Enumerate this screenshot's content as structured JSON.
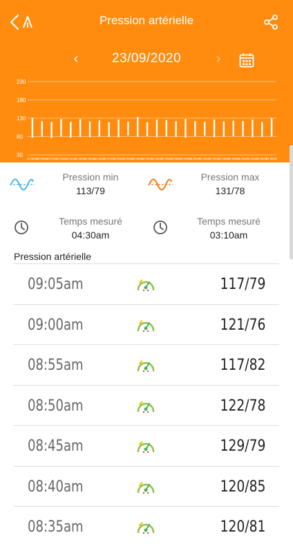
{
  "header": {
    "title": "Pression artérielle",
    "back_icon": "chevron-left-icon",
    "brand_icon": "app-logo-icon",
    "share_icon": "share-icon",
    "background": "#ff8c0f"
  },
  "date_nav": {
    "date": "23/09/2020",
    "prev_symbol": "‹",
    "next_symbol": "›",
    "calendar_icon": "calendar-icon"
  },
  "chart_data": {
    "type": "range-bar",
    "y_ticks": [
      230,
      180,
      130,
      80,
      30
    ],
    "ylim": [
      30,
      230
    ],
    "grid": true,
    "x_tick_labels": [
      "12:00am",
      "12:06am",
      "12:07am",
      "12:10am",
      "12:11am",
      "12:18am",
      "12:20am",
      "12:22am",
      "12:27am",
      "12:30am",
      "12:36am",
      "12:40am",
      "12:44am",
      "12:45am",
      "12:50am",
      "12:55am",
      "01:00am",
      "01:06am",
      "01:10am",
      "01:15am",
      "01:18am",
      "01:20am",
      "01:25am",
      "01:30am",
      "01:35am",
      "01:40am"
    ],
    "series": [
      {
        "values_min": [
          77,
          80,
          76,
          80,
          77,
          79,
          78,
          80,
          79,
          78,
          83,
          79,
          81,
          78,
          80,
          79,
          77,
          80,
          82,
          78,
          79,
          81,
          80,
          78,
          79,
          80
        ],
        "values_max": [
          131,
          122,
          120,
          128,
          120,
          127,
          121,
          124,
          119,
          126,
          121,
          133,
          119,
          126,
          125,
          122,
          128,
          122,
          120,
          126,
          121,
          123,
          122,
          126,
          120,
          131
        ]
      }
    ],
    "color": "#ffffff"
  },
  "summary": {
    "min_label": "Pression min",
    "min_value": "113/79",
    "max_label": "Pression max",
    "max_value": "131/78",
    "min_time_label": "Temps mesuré",
    "min_time_value": "04:30am",
    "max_time_label": "Temps mesuré",
    "max_time_value": "03:10am",
    "min_icon": "wave-blue-icon",
    "max_icon": "wave-orange-icon",
    "clock_icon": "clock-icon",
    "min_color": "#4ab3e8",
    "max_color": "#f07a1a"
  },
  "list": {
    "title": "Pression artérielle",
    "rows": [
      {
        "time": "09:05am",
        "value": "117/79"
      },
      {
        "time": "09:00am",
        "value": "121/76"
      },
      {
        "time": "08:55am",
        "value": "117/82"
      },
      {
        "time": "08:50am",
        "value": "122/78"
      },
      {
        "time": "08:45am",
        "value": "129/79"
      },
      {
        "time": "08:40am",
        "value": "120/85"
      },
      {
        "time": "08:35am",
        "value": "120/81"
      }
    ],
    "gauge_icon": "gauge-icon"
  }
}
